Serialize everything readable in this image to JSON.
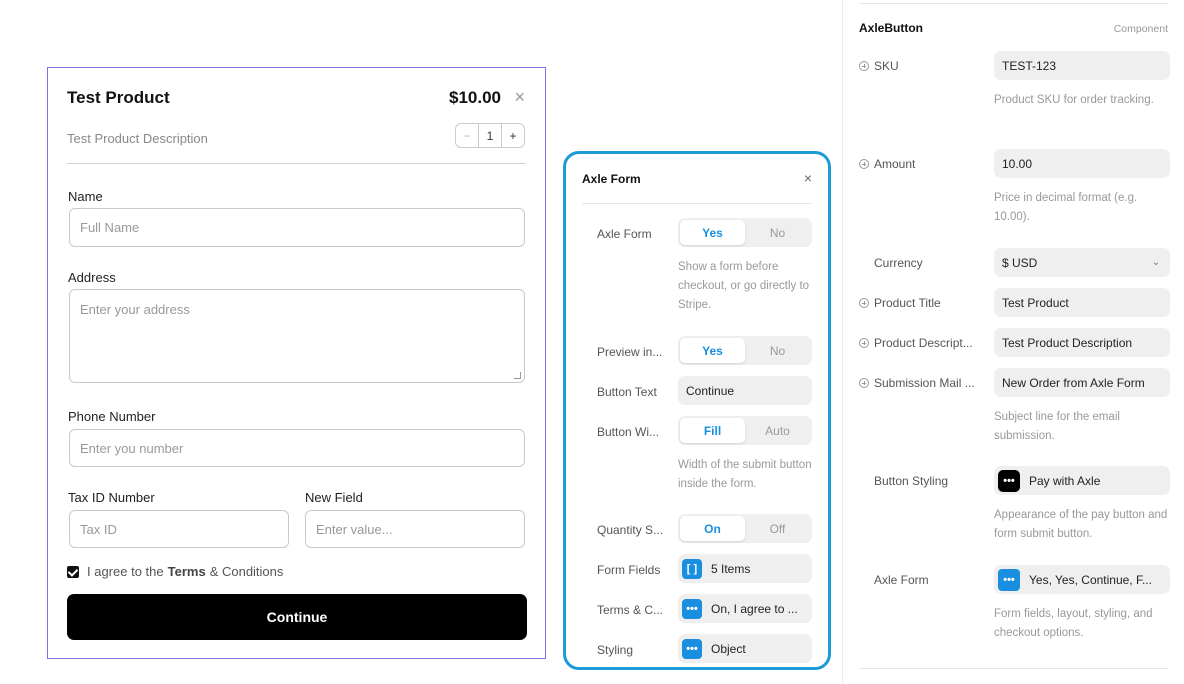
{
  "product": {
    "title": "Test Product",
    "price": "$10.00",
    "close": "×",
    "description": "Test Product Description",
    "qty_minus": "−",
    "qty_value": "1",
    "qty_plus": "+",
    "fields": {
      "name_label": "Name",
      "name_placeholder": "Full Name",
      "address_label": "Address",
      "address_placeholder": "Enter your address",
      "phone_label": "Phone Number",
      "phone_placeholder": "Enter you number",
      "tax_label": "Tax ID Number",
      "tax_placeholder": "Tax ID",
      "new_label": "New Field",
      "new_placeholder": "Enter value..."
    },
    "agree_pre": "I agree to the",
    "agree_bold": "Terms",
    "agree_post": "& Conditions",
    "continue": "Continue"
  },
  "popover": {
    "title": "Axle Form",
    "close": "×",
    "axle_form_label": "Axle Form",
    "yes": "Yes",
    "no": "No",
    "axle_form_help": "Show a form before checkout, or go directly to Stripe.",
    "preview_label": "Preview in...",
    "button_text_label": "Button Text",
    "button_text_value": "Continue",
    "button_width_label": "Button Wi...",
    "fill": "Fill",
    "auto": "Auto",
    "button_width_help": "Width of the submit button inside the form.",
    "quantity_label": "Quantity S...",
    "on": "On",
    "off": "Off",
    "form_fields_label": "Form Fields",
    "form_fields_icon": "[ ]",
    "form_fields_value": "5 Items",
    "terms_label": "Terms & C...",
    "terms_icon": "•••",
    "terms_value": "On, I agree to ...",
    "styling_label": "Styling",
    "styling_icon": "•••",
    "styling_value": "Object"
  },
  "panel": {
    "title": "AxleButton",
    "subtitle": "Component",
    "sku_label": "SKU",
    "sku_value": "TEST-123",
    "sku_help": "Product SKU for order tracking.",
    "amount_label": "Amount",
    "amount_value": "10.00",
    "amount_help": "Price in decimal format (e.g. 10.00).",
    "currency_label": "Currency",
    "currency_value": "$ USD",
    "currency_chevron": "⌄",
    "product_title_label": "Product Title",
    "product_title_value": "Test Product",
    "product_desc_label": "Product Descript...",
    "product_desc_value": "Test Product Description",
    "submission_label": "Submission Mail ...",
    "submission_value": "New Order from Axle Form",
    "submission_help": "Subject line for the email submission.",
    "button_styling_label": "Button Styling",
    "button_styling_icon": "•••",
    "button_styling_value": "Pay with Axle",
    "button_styling_help": "Appearance of the pay button and form submit button.",
    "axle_form_label": "Axle Form",
    "axle_form_icon": "•••",
    "axle_form_value": "Yes, Yes, Continue, F...",
    "axle_form_help": "Form fields, layout, styling, and checkout options."
  }
}
